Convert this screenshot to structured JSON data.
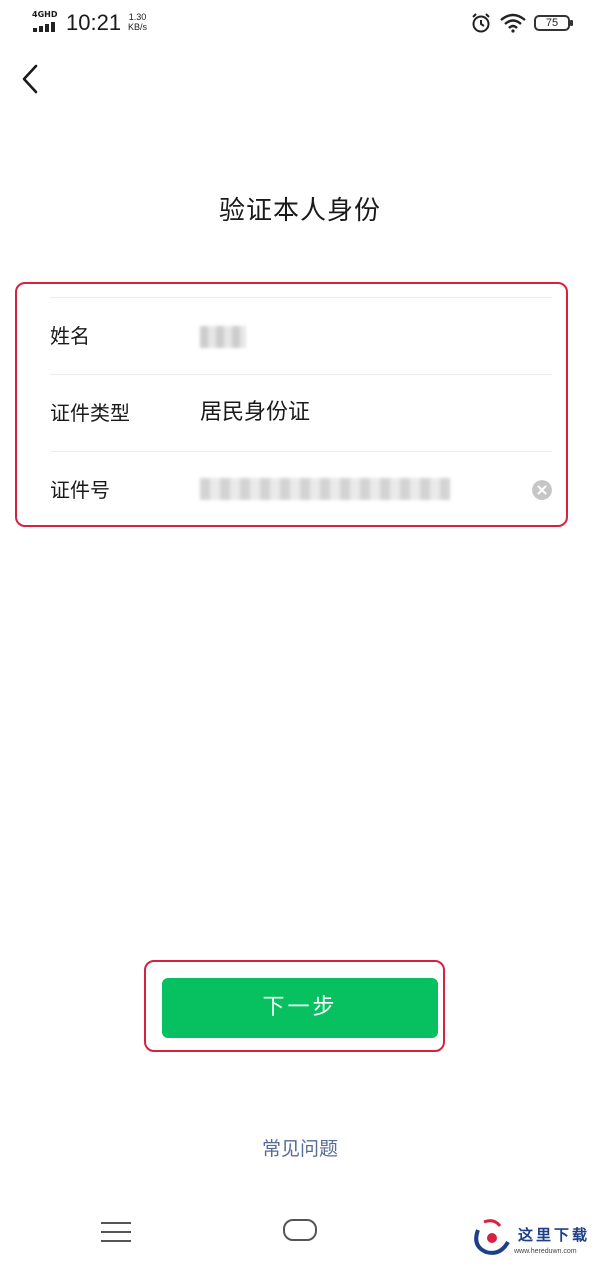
{
  "status_bar": {
    "network": "4GHD",
    "time": "10:21",
    "speed_value": "1.30",
    "speed_unit": "KB/s",
    "battery": "75",
    "icons": [
      "signal-icon",
      "alarm-icon",
      "wifi-icon",
      "battery-icon"
    ]
  },
  "header": {
    "back_icon": "chevron-left-icon"
  },
  "page": {
    "title": "验证本人身份"
  },
  "form": {
    "rows": [
      {
        "label": "姓名",
        "value": ""
      },
      {
        "label": "证件类型",
        "value": "居民身份证"
      },
      {
        "label": "证件号",
        "value": ""
      }
    ],
    "clear_icon": "clear-circle-icon"
  },
  "actions": {
    "next_label": "下一步",
    "faq_label": "常见问题"
  },
  "colors": {
    "primary": "#07c160",
    "highlight_border": "#d6223f",
    "link": "#576b95"
  },
  "nav_bar": {
    "icons": [
      "menu-icon",
      "home-icon",
      "back-icon"
    ]
  },
  "watermark": {
    "text": "这里下载",
    "url": "www.hereduwn.com"
  }
}
